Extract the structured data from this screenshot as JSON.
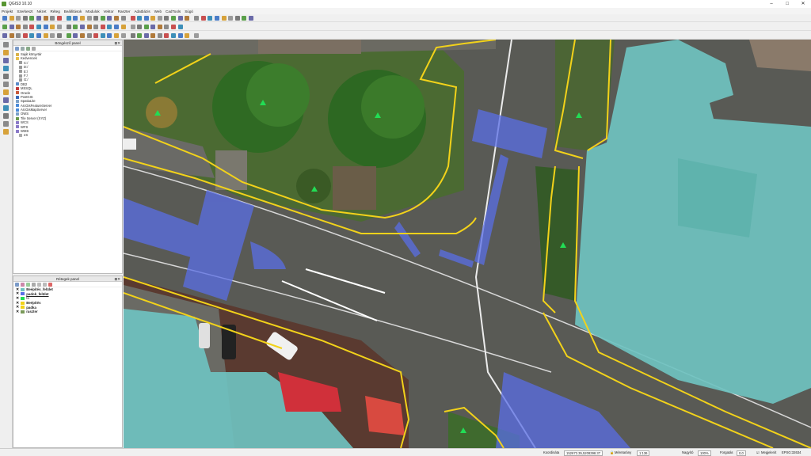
{
  "window": {
    "title": "QGIS3 10.10"
  },
  "menu": [
    "Projekt",
    "Szerkeszt",
    "Nézet",
    "Réteg",
    "Beállítások",
    "Modulok",
    "Vektor",
    "Raszter",
    "Adatbázis",
    "Web",
    "CadTools",
    "Súgó"
  ],
  "browser_panel": {
    "title": "Böngésző panel",
    "items": [
      "Saját könyvtár",
      "Kedvencek",
      "C:/",
      "D:/",
      "E:/",
      "F:/",
      "G:/",
      "DB2",
      "MSSQL",
      "Oracle",
      "PostGIS",
      "SpatiaLite",
      "ArcGisFeatureServer",
      "ArcGisMapServer",
      "OWS",
      "Tile Server (XYZ)",
      "WCS",
      "WFS",
      "WMS",
      "eS"
    ]
  },
  "layers_panel": {
    "title": "Rétegek panel",
    "layers": [
      {
        "name": "Beépítés_felület",
        "bold": true,
        "underline": false
      },
      {
        "name": "padok_felület",
        "bold": true,
        "underline": true
      },
      {
        "name": "fa",
        "bold": false,
        "underline": false
      },
      {
        "name": "Beépítés",
        "bold": true,
        "underline": false
      },
      {
        "name": "padka",
        "bold": true,
        "underline": false
      },
      {
        "name": "raszter",
        "bold": true,
        "underline": false
      }
    ]
  },
  "statusbar": {
    "coord_label": "Koordináta",
    "coord_value": "152673.35,5208398.37",
    "scale_label": "Méretarány",
    "scale_value": "1:136",
    "magnifier_label": "Nagyító",
    "magnifier_value": "100%",
    "rotation_label": "Forgatás",
    "rotation_value": "0,0",
    "render_label": "Megjelenít",
    "crs_label": "EPSG:32634"
  },
  "colors": {
    "accent": "#589632",
    "boundary": "#f2d21a",
    "building_fill": "#6fc2c0",
    "crosswalk": "#5a6ee6",
    "tree_marker": "#22dd55"
  }
}
